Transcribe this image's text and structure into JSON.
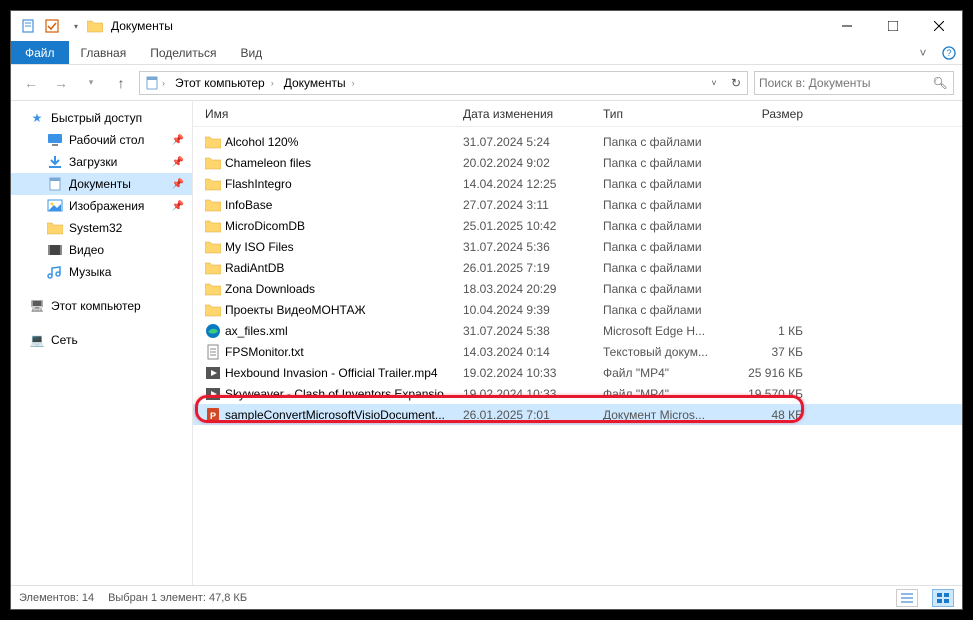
{
  "title": "Документы",
  "ribbon": {
    "file": "Файл",
    "tabs": [
      "Главная",
      "Поделиться",
      "Вид"
    ]
  },
  "breadcrumb": [
    "Этот компьютер",
    "Документы"
  ],
  "search_placeholder": "Поиск в: Документы",
  "sidebar": {
    "quick_access": "Быстрый доступ",
    "quick_items": [
      {
        "label": "Рабочий стол",
        "icon": "desktop",
        "pinned": true
      },
      {
        "label": "Загрузки",
        "icon": "downloads",
        "pinned": true
      },
      {
        "label": "Документы",
        "icon": "documents",
        "pinned": true,
        "selected": true
      },
      {
        "label": "Изображения",
        "icon": "pictures",
        "pinned": true
      },
      {
        "label": "System32",
        "icon": "folder",
        "pinned": false
      },
      {
        "label": "Видео",
        "icon": "video",
        "pinned": false
      },
      {
        "label": "Музыка",
        "icon": "music",
        "pinned": false
      }
    ],
    "this_pc": "Этот компьютер",
    "network": "Сеть"
  },
  "columns": {
    "name": "Имя",
    "date": "Дата изменения",
    "type": "Тип",
    "size": "Размер"
  },
  "rows": [
    {
      "icon": "folder",
      "name": "Alcohol 120%",
      "date": "31.07.2024 5:24",
      "type": "Папка с файлами",
      "size": ""
    },
    {
      "icon": "folder",
      "name": "Chameleon files",
      "date": "20.02.2024 9:02",
      "type": "Папка с файлами",
      "size": ""
    },
    {
      "icon": "folder",
      "name": "FlashIntegro",
      "date": "14.04.2024 12:25",
      "type": "Папка с файлами",
      "size": ""
    },
    {
      "icon": "folder",
      "name": "InfoBase",
      "date": "27.07.2024 3:11",
      "type": "Папка с файлами",
      "size": ""
    },
    {
      "icon": "folder",
      "name": "MicroDicomDB",
      "date": "25.01.2025 10:42",
      "type": "Папка с файлами",
      "size": ""
    },
    {
      "icon": "folder",
      "name": "My ISO Files",
      "date": "31.07.2024 5:36",
      "type": "Папка с файлами",
      "size": ""
    },
    {
      "icon": "folder",
      "name": "RadiAntDB",
      "date": "26.01.2025 7:19",
      "type": "Папка с файлами",
      "size": ""
    },
    {
      "icon": "folder",
      "name": "Zona Downloads",
      "date": "18.03.2024 20:29",
      "type": "Папка с файлами",
      "size": ""
    },
    {
      "icon": "folder",
      "name": "Проекты ВидеоМОНТАЖ",
      "date": "10.04.2024 9:39",
      "type": "Папка с файлами",
      "size": ""
    },
    {
      "icon": "edge",
      "name": "ax_files.xml",
      "date": "31.07.2024 5:38",
      "type": "Microsoft Edge H...",
      "size": "1 КБ"
    },
    {
      "icon": "txt",
      "name": "FPSMonitor.txt",
      "date": "14.03.2024 0:14",
      "type": "Текстовый докум...",
      "size": "37 КБ"
    },
    {
      "icon": "mp4",
      "name": "Hexbound Invasion - Official Trailer.mp4",
      "date": "19.02.2024 10:33",
      "type": "Файл \"MP4\"",
      "size": "25 916 КБ"
    },
    {
      "icon": "mp4",
      "name": "Skyweaver - Clash of Inventors Expansio",
      "date": "19.02.2024 10:33",
      "type": "Файл \"MP4\"",
      "size": "19 570 КБ"
    },
    {
      "icon": "ppt",
      "name": "sampleConvertMicrosoftVisioDocument...",
      "date": "26.01.2025 7:01",
      "type": "Документ Micros...",
      "size": "48 КБ",
      "selected": true
    }
  ],
  "status": {
    "count": "Элементов: 14",
    "selection": "Выбран 1 элемент: 47,8 КБ"
  }
}
